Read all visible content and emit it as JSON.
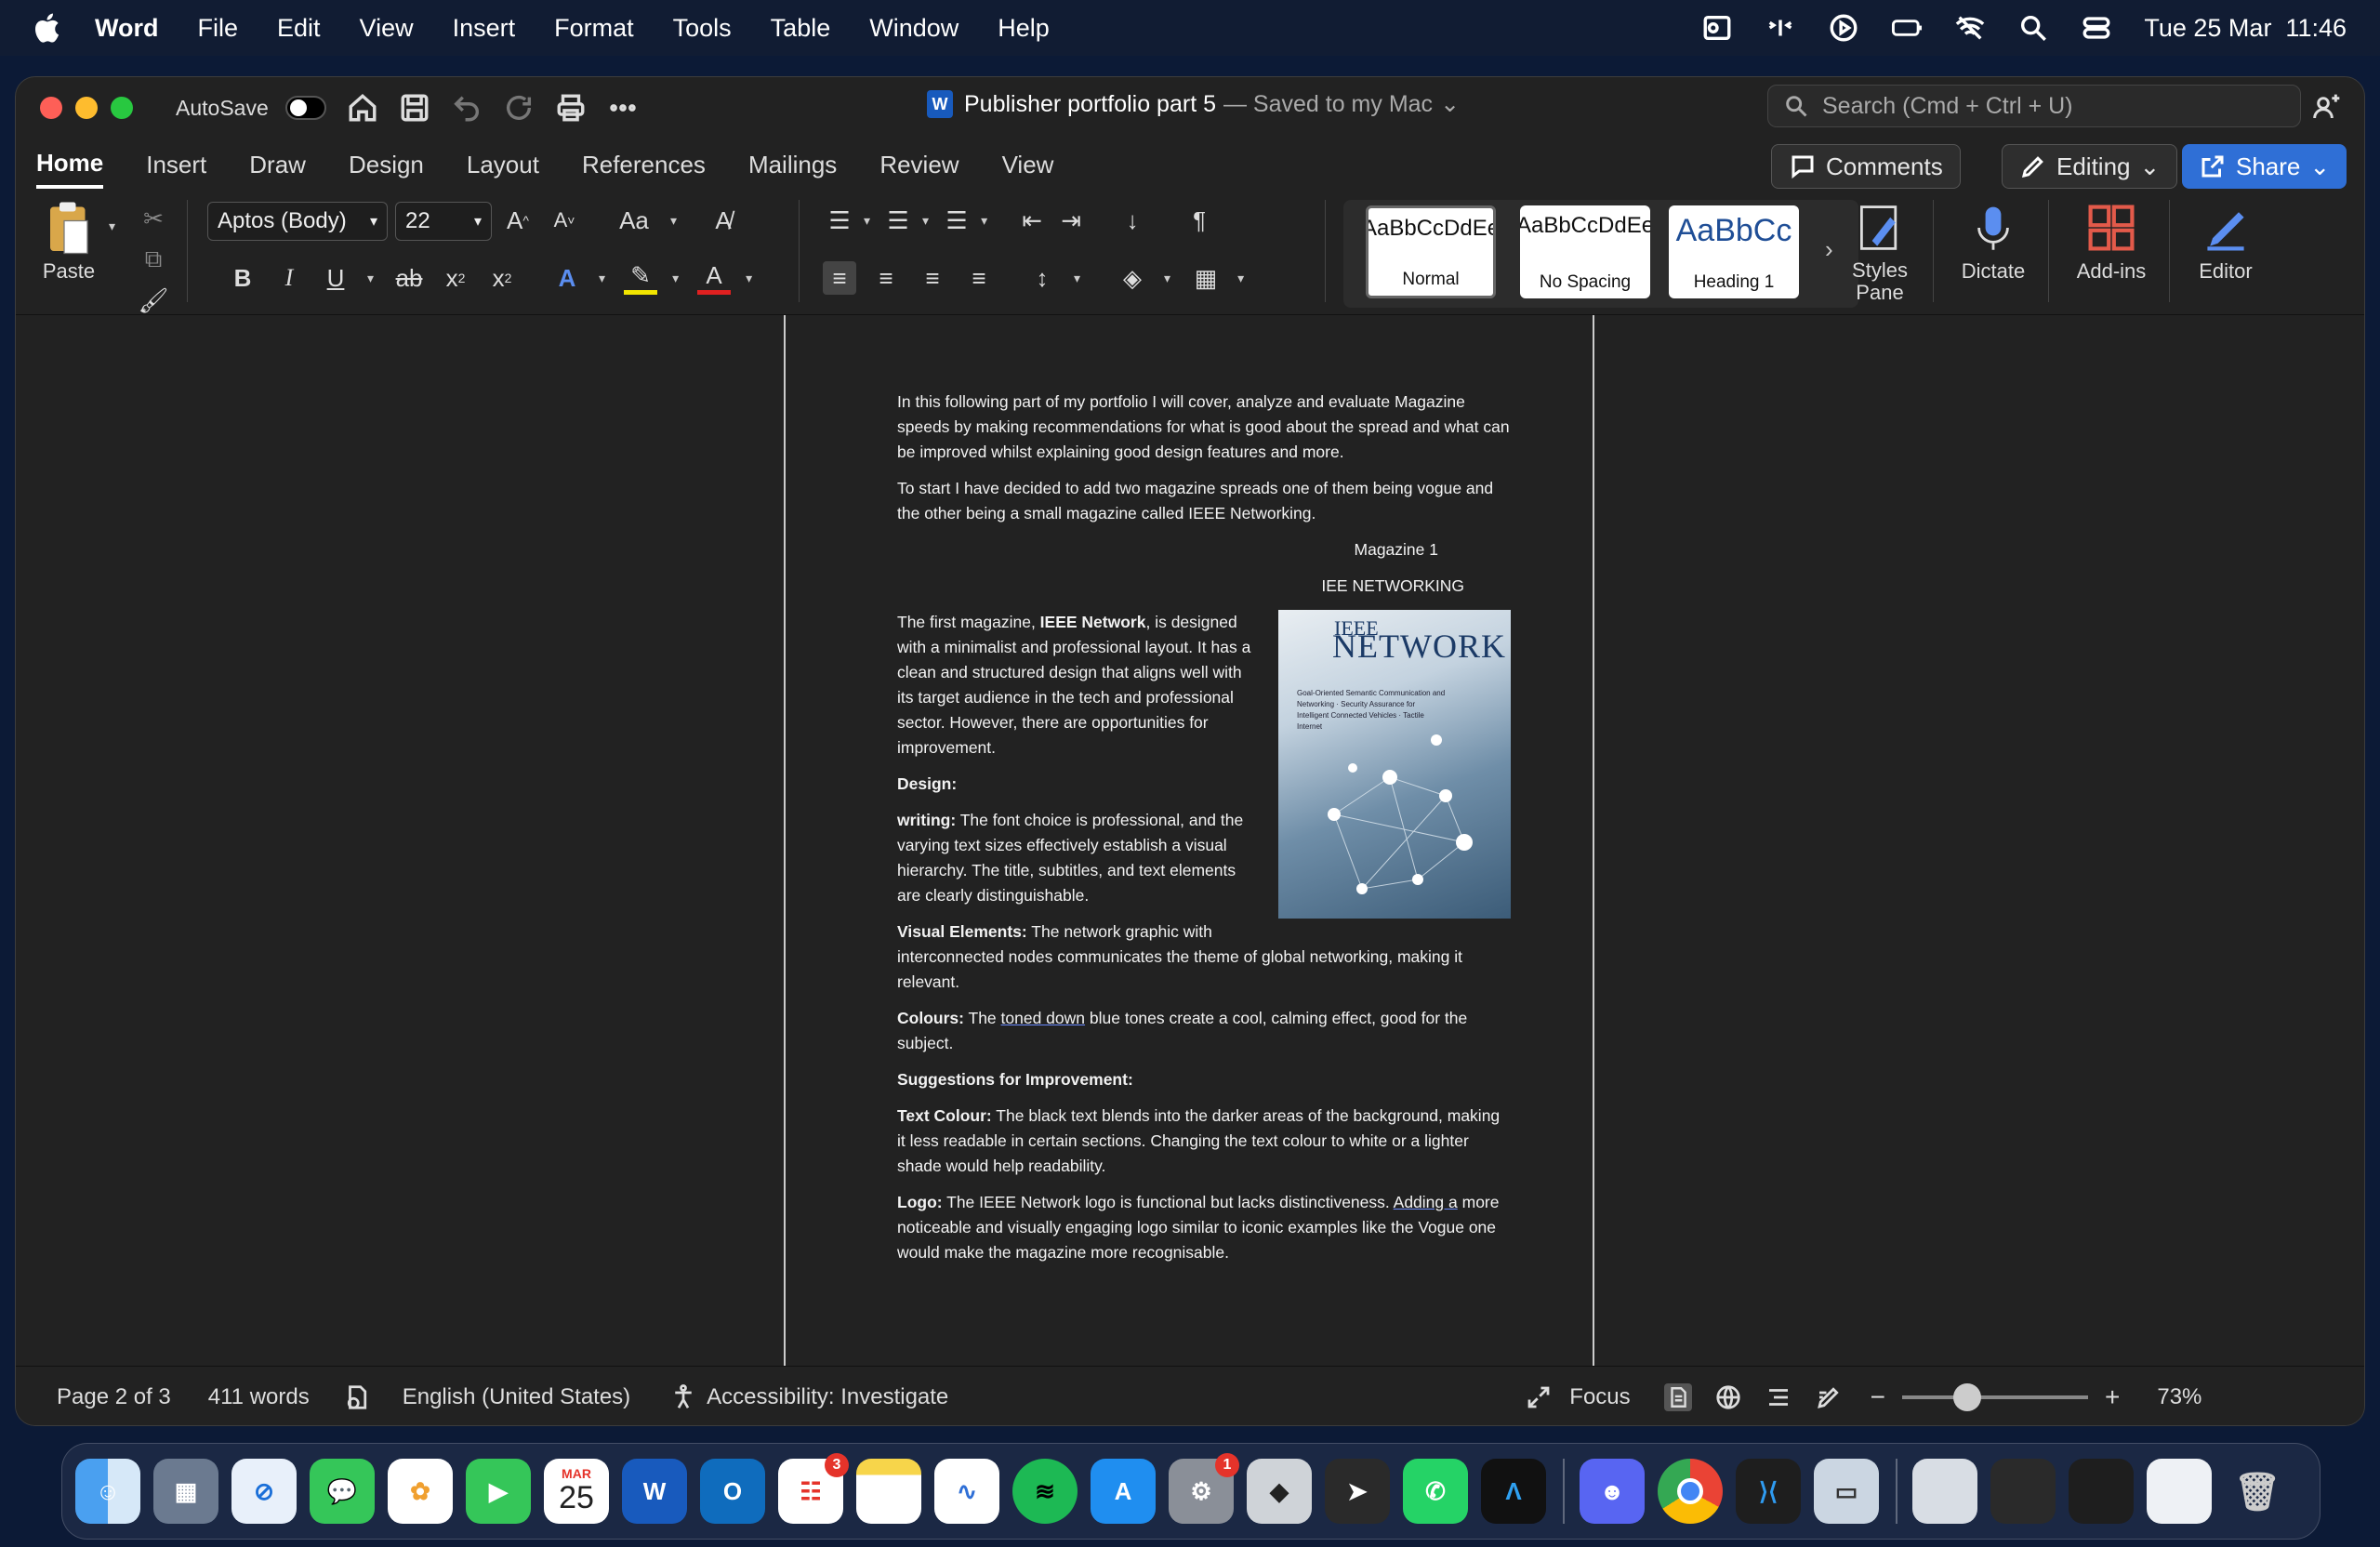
{
  "menubar": {
    "app": "Word",
    "items": [
      "File",
      "Edit",
      "View",
      "Insert",
      "Format",
      "Tools",
      "Table",
      "Window",
      "Help"
    ],
    "datetime": "Tue 25 Mar  11:46"
  },
  "titlebar": {
    "autosave": "AutoSave",
    "doc_title": "Publisher portfolio part 5",
    "saved": "— Saved to my Mac",
    "search_placeholder": "Search (Cmd + Ctrl + U)"
  },
  "tabs": [
    "Home",
    "Insert",
    "Draw",
    "Design",
    "Layout",
    "References",
    "Mailings",
    "Review",
    "View"
  ],
  "buttons": {
    "comments": "Comments",
    "editing": "Editing",
    "share": "Share"
  },
  "ribbon": {
    "paste": "Paste",
    "font": "Aptos (Body)",
    "size": "22",
    "styles": [
      {
        "preview": "AaBbCcDdEe",
        "name": "Normal"
      },
      {
        "preview": "AaBbCcDdEe",
        "name": "No Spacing"
      },
      {
        "preview": "AaBbCc",
        "name": "Heading 1"
      }
    ],
    "styles_pane": "Styles Pane",
    "dictate": "Dictate",
    "addins": "Add-ins",
    "editor": "Editor"
  },
  "doc": {
    "p1": "In this following part of my portfolio I will cover, analyze and evaluate Magazine speeds by making recommendations for what is good about the spread and what can be improved whilst explaining good design features and more.",
    "p2": "To start I have decided to add two magazine spreads one of them being vogue and the other being a small magazine called IEEE Networking.",
    "mag_label": "Magazine 1",
    "mag_name": "IEE NETWORKING",
    "p3a": "The first magazine, ",
    "p3b": "IEEE Network",
    "p3c": ", is designed with a minimalist and professional layout. It has a clean and structured design that aligns well with its target audience in the tech and professional sector. However, there are opportunities for improvement.",
    "design": "Design:",
    "writing_h": "writing:",
    "writing": " The font choice is professional, and the varying text sizes effectively establish a visual hierarchy. The title, subtitles, and text elements are clearly distinguishable.",
    "visual_h": "Visual Elements:",
    "visual": " The network graphic with interconnected nodes communicates the theme of global networking, making it relevant.",
    "colours_h": "Colours:",
    "colours_a": " The ",
    "colours_u": "toned down",
    "colours_b": " blue tones create a cool, calming effect, good for the subject.",
    "suggest": "Suggestions for Improvement:",
    "textc_h": "Text Colour:",
    "textc": " The black text blends into the darker areas of the background, making it less readable in certain sections. Changing the text colour to white or a lighter shade would help readability.",
    "logo_h": "Logo:",
    "logo_a": " The IEEE Network logo is functional but lacks distinctiveness. ",
    "logo_u": "Adding  a",
    "logo_b": " more noticeable and visually engaging logo similar to iconic examples like the Vogue one would make the magazine more recognisable.",
    "cover": {
      "t1": "IEEE",
      "t2": "NETWORK",
      "t3": "Goal-Oriented Semantic Communication and Networking · Security Assurance for Intelligent Connected Vehicles · Tactile Internet"
    }
  },
  "status": {
    "page": "Page 2 of 3",
    "words": "411 words",
    "lang": "English (United States)",
    "access": "Accessibility: Investigate",
    "focus": "Focus",
    "zoom": "73%",
    "zoom_level": 0.73
  },
  "dock": {
    "calendar_month": "MAR",
    "calendar_day": "25",
    "reminders_badge": "3",
    "settings_badge": "1"
  }
}
